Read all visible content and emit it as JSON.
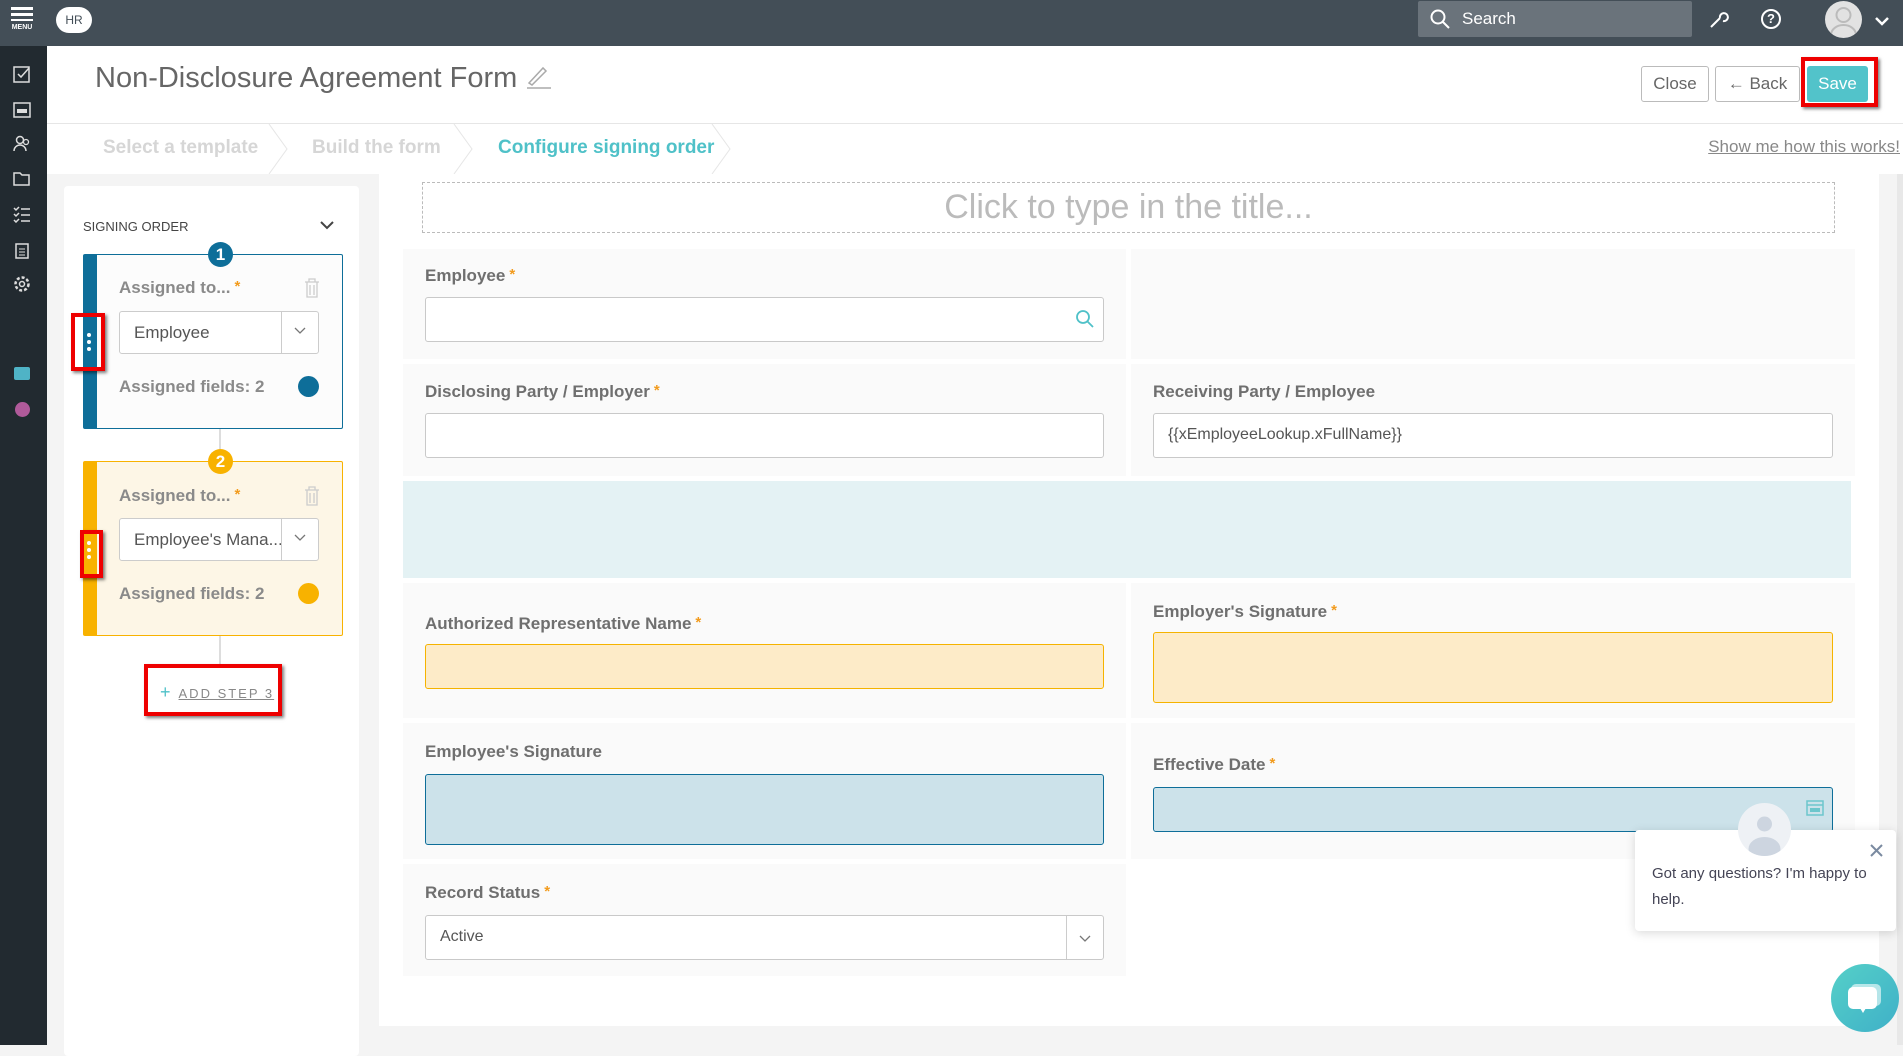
{
  "topbar": {
    "menu_label": "MENU",
    "logo_text": "HR",
    "search_placeholder": "Search"
  },
  "header": {
    "title": "Non-Disclosure Agreement Form",
    "close_label": "Close",
    "back_label": "← Back",
    "save_label": "Save"
  },
  "steps": [
    {
      "label": "Select a template",
      "state": "inactive"
    },
    {
      "label": "Build the form",
      "state": "inactive"
    },
    {
      "label": "Configure signing order",
      "state": "active"
    }
  ],
  "help_link": "Show me how this works!",
  "signing_order": {
    "title": "SIGNING ORDER",
    "steps": [
      {
        "number": "1",
        "assigned_label": "Assigned to...",
        "required": "*",
        "value": "Employee",
        "fields": "Assigned fields: 2",
        "color": "#0e6e99"
      },
      {
        "number": "2",
        "assigned_label": "Assigned to...",
        "required": "*",
        "value": "Employee's Mana...",
        "fields": "Assigned fields: 2",
        "color": "#f8b200"
      }
    ],
    "add_step": "ADD STEP 3"
  },
  "form": {
    "title_placeholder": "Click to type in the title...",
    "fields": {
      "employee": {
        "label": "Employee",
        "required": "*",
        "value": ""
      },
      "disclosing": {
        "label": "Disclosing Party / Employer",
        "required": "*",
        "value": ""
      },
      "receiving": {
        "label": "Receiving Party / Employee",
        "value": "{{xEmployeeLookup.xFullName}}"
      },
      "auth_rep": {
        "label": "Authorized Representative Name",
        "required": "*",
        "value": ""
      },
      "employer_sig": {
        "label": "Employer's Signature",
        "required": "*",
        "value": ""
      },
      "employee_sig": {
        "label": "Employee's Signature",
        "value": ""
      },
      "effective_date": {
        "label": "Effective Date",
        "required": "*",
        "value": ""
      },
      "record_status": {
        "label": "Record Status",
        "required": "*",
        "value": "Active"
      }
    }
  },
  "chat": {
    "message": "Got any questions? I'm happy to help."
  },
  "colors": {
    "accent": "#4fc1c8",
    "step1": "#0e6e99",
    "step2": "#f8b200",
    "highlight": "#e00000"
  }
}
